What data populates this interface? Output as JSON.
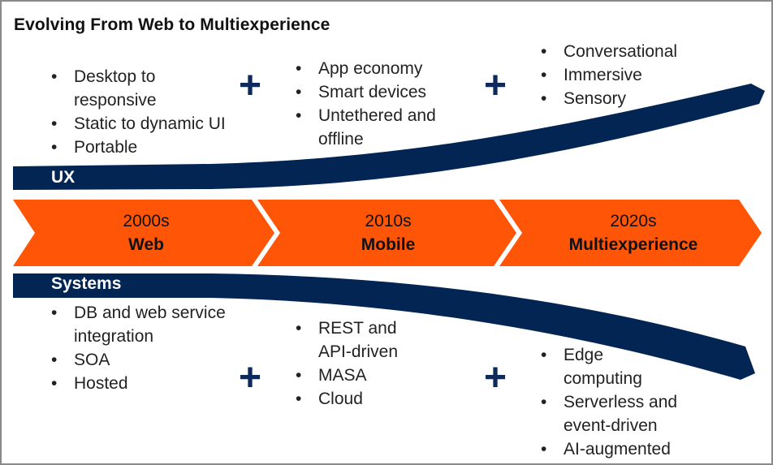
{
  "title": "Evolving From Web to Multiexperience",
  "colors": {
    "navy": "#022553",
    "orange": "#fe5507",
    "text": "#222222"
  },
  "bands": {
    "ux_label": "UX",
    "systems_label": "Systems"
  },
  "eras": [
    {
      "year": "2000s",
      "name": "Web"
    },
    {
      "year": "2010s",
      "name": "Mobile"
    },
    {
      "year": "2020s",
      "name": "Multiexperience"
    }
  ],
  "ux": {
    "col1": [
      "Desktop to responsive",
      "Static to dynamic UI",
      "Portable"
    ],
    "col2": [
      "App economy",
      "Smart devices",
      "Untethered and offline"
    ],
    "col3": [
      "Conversational",
      "Immersive",
      "Sensory"
    ]
  },
  "systems": {
    "col1": [
      "DB and web service integration",
      "SOA",
      "Hosted"
    ],
    "col2": [
      "REST and API-driven",
      "MASA",
      "Cloud"
    ],
    "col3": [
      "Edge computing",
      "Serverless and event-driven",
      "AI-augmented"
    ]
  },
  "plus_symbol": "+"
}
